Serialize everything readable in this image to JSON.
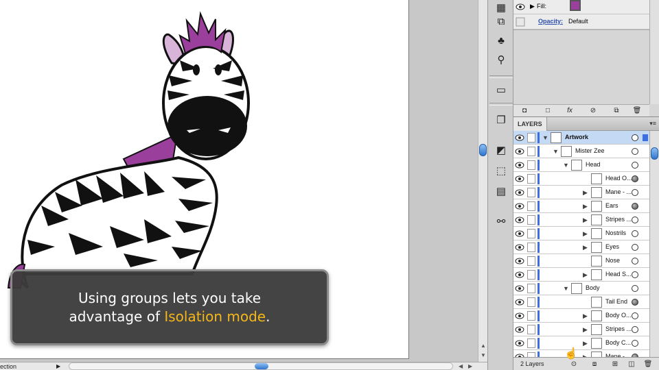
{
  "status_bar": {
    "text": "ection",
    "play_icon": "play-triangle-icon"
  },
  "caption": {
    "line1": "Using groups lets you take",
    "line2_prefix": "advantage of ",
    "highlight": "Isolation mode",
    "line2_suffix": "."
  },
  "colors": {
    "accent_highlight": "#f6b71a",
    "layer_color": "#3d6fe0",
    "fill_color": "#9a3f9b",
    "selection_bg": "#c4d9f4"
  },
  "appearance": {
    "fill_label": "Fill:",
    "opacity_label": "Opacity:",
    "opacity_value": "Default",
    "bottom_icons": [
      "new-art-icon",
      "clear-icon",
      "fx-icon",
      "no-icon",
      "duplicate-icon",
      "delete-icon"
    ]
  },
  "tools": [
    "graphic-styles-icon",
    "transform-icon",
    "symbols-icon",
    "puppet-icon",
    "gradient-icon",
    "copy-icon",
    "align-icon",
    "transform-box-icon",
    "align-left-icon",
    "link-icon"
  ],
  "layers": {
    "tab_label": "LAYERS",
    "count_label": "2 Layers",
    "rows": [
      {
        "name": "Artwork",
        "level": 0,
        "expanded": "open",
        "selected": true,
        "target_filled": false,
        "sel_marker": true
      },
      {
        "name": "Mister Zee",
        "level": 1,
        "expanded": "open",
        "selected": false,
        "target_filled": false,
        "sel_marker": false
      },
      {
        "name": "Head",
        "level": 2,
        "expanded": "open",
        "selected": false,
        "target_filled": false,
        "sel_marker": false
      },
      {
        "name": "Head O...",
        "level": 3,
        "expanded": "none",
        "selected": false,
        "target_filled": true,
        "sel_marker": false
      },
      {
        "name": "Mane - ...",
        "level": 3,
        "expanded": "closed",
        "selected": false,
        "target_filled": false,
        "sel_marker": false
      },
      {
        "name": "Ears",
        "level": 3,
        "expanded": "closed",
        "selected": false,
        "target_filled": true,
        "sel_marker": false
      },
      {
        "name": "Stripes ...",
        "level": 3,
        "expanded": "closed",
        "selected": false,
        "target_filled": false,
        "sel_marker": false
      },
      {
        "name": "Nostrils",
        "level": 3,
        "expanded": "closed",
        "selected": false,
        "target_filled": false,
        "sel_marker": false
      },
      {
        "name": "Eyes",
        "level": 3,
        "expanded": "closed",
        "selected": false,
        "target_filled": false,
        "sel_marker": false
      },
      {
        "name": "Nose",
        "level": 3,
        "expanded": "none",
        "selected": false,
        "target_filled": false,
        "sel_marker": false
      },
      {
        "name": "Head S...",
        "level": 3,
        "expanded": "closed",
        "selected": false,
        "target_filled": false,
        "sel_marker": false
      },
      {
        "name": "Body",
        "level": 2,
        "expanded": "open",
        "selected": false,
        "target_filled": false,
        "sel_marker": false
      },
      {
        "name": "Tail End",
        "level": 3,
        "expanded": "none",
        "selected": false,
        "target_filled": true,
        "sel_marker": false
      },
      {
        "name": "Body O...",
        "level": 3,
        "expanded": "closed",
        "selected": false,
        "target_filled": false,
        "sel_marker": false
      },
      {
        "name": "Stripes ...",
        "level": 3,
        "expanded": "closed",
        "selected": false,
        "target_filled": false,
        "sel_marker": false
      },
      {
        "name": "Body C...",
        "level": 3,
        "expanded": "closed",
        "selected": false,
        "target_filled": false,
        "sel_marker": false
      },
      {
        "name": "Mane - ...",
        "level": 3,
        "expanded": "closed",
        "selected": false,
        "target_filled": true,
        "sel_marker": false
      }
    ],
    "footer_icons": [
      "locate-object-icon",
      "make-clipping-mask-icon",
      "new-sublayer-icon",
      "new-layer-icon",
      "delete-layer-icon"
    ]
  }
}
